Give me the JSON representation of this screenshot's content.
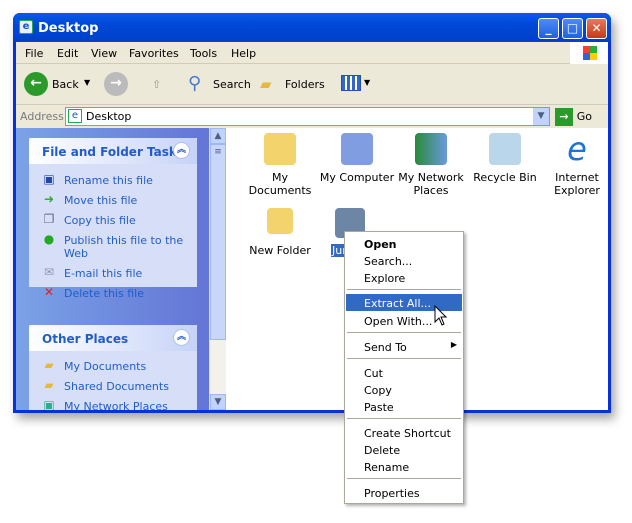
{
  "window": {
    "title": "Desktop"
  },
  "menubar": [
    "File",
    "Edit",
    "View",
    "Favorites",
    "Tools",
    "Help"
  ],
  "toolbar": {
    "back": "Back",
    "search": "Search",
    "folders": "Folders"
  },
  "address": {
    "label": "Address",
    "value": "Desktop",
    "go": "Go"
  },
  "tasks": {
    "title": "File and Folder Tasks",
    "items": [
      "Rename this file",
      "Move this file",
      "Copy this file",
      "Publish this file to the Web",
      "E-mail this file",
      "Delete this file"
    ]
  },
  "places": {
    "title": "Other Places",
    "items": [
      "My Documents",
      "Shared Documents",
      "My Network Places"
    ]
  },
  "icons": [
    "My Documents",
    "My Computer",
    "My Network Places",
    "Recycle Bin",
    "Internet Explorer",
    "New Folder",
    "Junct"
  ],
  "context_menu": [
    "Open",
    "Search...",
    "Explore",
    "Extract All...",
    "Open With...",
    "Send To",
    "Cut",
    "Copy",
    "Paste",
    "Create Shortcut",
    "Delete",
    "Rename",
    "Properties"
  ]
}
